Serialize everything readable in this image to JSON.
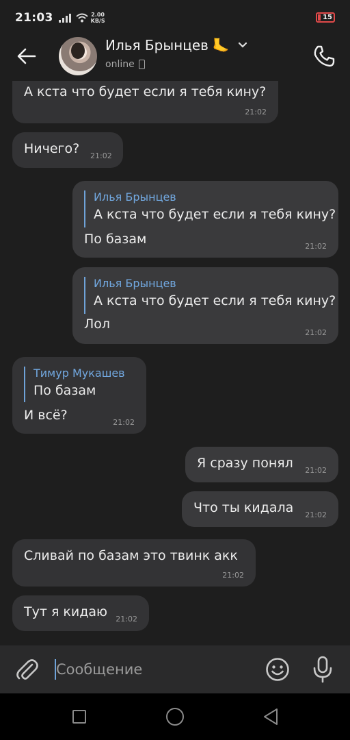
{
  "status_bar": {
    "time": "21:03",
    "net_speed_value": "2.00",
    "net_speed_unit": "KB/S",
    "battery": "15",
    "battery_color": "#e24a4a"
  },
  "header": {
    "contact_name": "Илья Брынцев",
    "contact_emoji": "🦶",
    "contact_status": "online",
    "icons": [
      "back-arrow-icon",
      "chevron-down-icon",
      "phone-icon"
    ]
  },
  "colors": {
    "background": "#1e1e1e",
    "bubble_in": "#333335",
    "bubble_out": "#3a3a3c",
    "reply_accent": "#72a8e0"
  },
  "messages": [
    {
      "direction": "in",
      "text": "А кста что будет если я тебя кину?",
      "time": "21:02"
    },
    {
      "direction": "in",
      "text": "Ничего?",
      "time": "21:02"
    },
    {
      "direction": "out",
      "reply_author": "Илья Брынцев",
      "reply_text": "А кста что будет если я тебя кину?",
      "text": "По базам",
      "time": "21:02"
    },
    {
      "direction": "out",
      "reply_author": "Илья Брынцев",
      "reply_text": "А кста что будет если я тебя кину?",
      "text": "Лол",
      "time": "21:02"
    },
    {
      "direction": "in",
      "reply_author": "Тимур Мукашев",
      "reply_text": "По базам",
      "text": "И всё?",
      "time": "21:02"
    },
    {
      "direction": "out",
      "text": "Я сразу понял",
      "time": "21:02"
    },
    {
      "direction": "out",
      "text": "Что ты кидала",
      "time": "21:02"
    },
    {
      "direction": "in",
      "text": "Сливай по базам это твинк акк",
      "time": "21:02"
    },
    {
      "direction": "in",
      "text": "Тут я кидаю",
      "time": "21:02"
    }
  ],
  "composer": {
    "placeholder": "Сообщение",
    "value": ""
  },
  "navbar": {
    "buttons": [
      "recent-apps-icon",
      "home-icon",
      "back-triangle-icon"
    ]
  }
}
